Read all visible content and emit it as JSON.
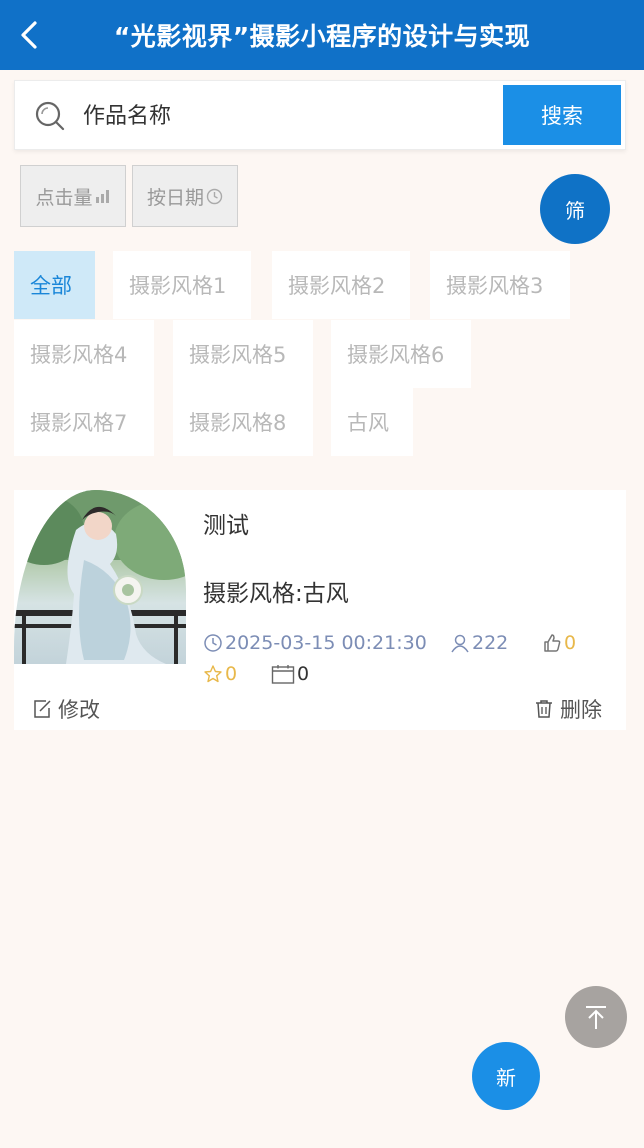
{
  "header": {
    "title": "“光影视界”摄影小程序的设计与实现",
    "back_icon": "chevron-left-icon"
  },
  "search": {
    "placeholder": "作品名称",
    "button_label": "搜索",
    "icon": "search-icon"
  },
  "sort": {
    "by_clicks_label": "点击量",
    "by_date_label": "按日期",
    "filter_label": "筛"
  },
  "categories": [
    {
      "label": "全部",
      "active": true
    },
    {
      "label": "摄影风格1"
    },
    {
      "label": "摄影风格2"
    },
    {
      "label": "摄影风格3"
    },
    {
      "label": "摄影风格4"
    },
    {
      "label": "摄影风格5"
    },
    {
      "label": "摄影风格6"
    },
    {
      "label": "摄影风格7"
    },
    {
      "label": "摄影风格8"
    },
    {
      "label": "古风"
    }
  ],
  "works": [
    {
      "title": "测试",
      "style": "摄影风格:古风",
      "datetime": "2025-03-15 00:21:30",
      "views": "222",
      "likes": "0",
      "favorites": "0",
      "comments": "0",
      "edit_label": "修改",
      "delete_label": "删除"
    }
  ],
  "fab": {
    "new_label": "新",
    "top_icon": "arrow-up-to-top-icon"
  },
  "colors": {
    "primary": "#1071c8",
    "accent": "#1b8fe6",
    "background": "#fdf7f3",
    "meta_blue": "#7c8db5",
    "meta_gold": "#e8b84a"
  }
}
